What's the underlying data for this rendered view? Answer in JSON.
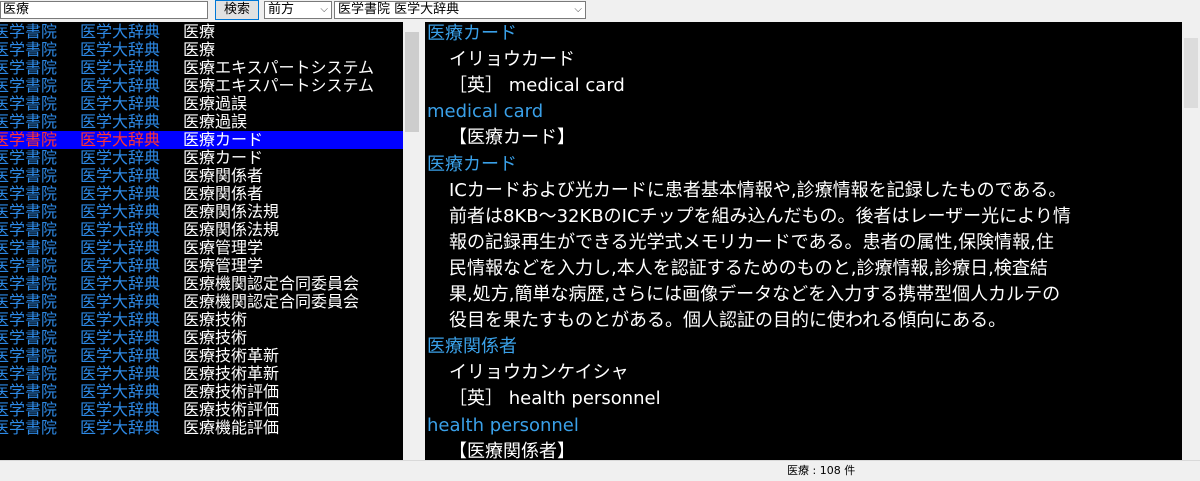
{
  "toolbar": {
    "search_value": "医療",
    "search_button": "検索",
    "match_mode": "前方",
    "dictionary": "医学書院 医学大辞典"
  },
  "results": [
    {
      "src": "医学書院",
      "dic": "医学大辞典",
      "term": "医療"
    },
    {
      "src": "医学書院",
      "dic": "医学大辞典",
      "term": "医療"
    },
    {
      "src": "医学書院",
      "dic": "医学大辞典",
      "term": "医療エキスパートシステム"
    },
    {
      "src": "医学書院",
      "dic": "医学大辞典",
      "term": "医療エキスパートシステム"
    },
    {
      "src": "医学書院",
      "dic": "医学大辞典",
      "term": "医療過誤"
    },
    {
      "src": "医学書院",
      "dic": "医学大辞典",
      "term": "医療過誤"
    },
    {
      "src": "医学書院",
      "dic": "医学大辞典",
      "term": "医療カード"
    },
    {
      "src": "医学書院",
      "dic": "医学大辞典",
      "term": "医療カード"
    },
    {
      "src": "医学書院",
      "dic": "医学大辞典",
      "term": "医療関係者"
    },
    {
      "src": "医学書院",
      "dic": "医学大辞典",
      "term": "医療関係者"
    },
    {
      "src": "医学書院",
      "dic": "医学大辞典",
      "term": "医療関係法規"
    },
    {
      "src": "医学書院",
      "dic": "医学大辞典",
      "term": "医療関係法規"
    },
    {
      "src": "医学書院",
      "dic": "医学大辞典",
      "term": "医療管理学"
    },
    {
      "src": "医学書院",
      "dic": "医学大辞典",
      "term": "医療管理学"
    },
    {
      "src": "医学書院",
      "dic": "医学大辞典",
      "term": "医療機関認定合同委員会"
    },
    {
      "src": "医学書院",
      "dic": "医学大辞典",
      "term": "医療機関認定合同委員会"
    },
    {
      "src": "医学書院",
      "dic": "医学大辞典",
      "term": "医療技術"
    },
    {
      "src": "医学書院",
      "dic": "医学大辞典",
      "term": "医療技術"
    },
    {
      "src": "医学書院",
      "dic": "医学大辞典",
      "term": "医療技術革新"
    },
    {
      "src": "医学書院",
      "dic": "医学大辞典",
      "term": "医療技術革新"
    },
    {
      "src": "医学書院",
      "dic": "医学大辞典",
      "term": "医療技術評価"
    },
    {
      "src": "医学書院",
      "dic": "医学大辞典",
      "term": "医療技術評価"
    },
    {
      "src": "医学書院",
      "dic": "医学大辞典",
      "term": "医療機能評価"
    }
  ],
  "selected_index": 6,
  "content": [
    {
      "kind": "h",
      "text": "医療カード"
    },
    {
      "kind": "t",
      "text": "イリョウカード"
    },
    {
      "kind": "t",
      "text": "［英］ medical card"
    },
    {
      "kind": "h",
      "text": "medical card"
    },
    {
      "kind": "t",
      "text": "【医療カード】"
    },
    {
      "kind": "h",
      "text": "医療カード"
    },
    {
      "kind": "t",
      "text": "ICカードおよび光カードに患者基本情報や,診療情報を記録したものである。"
    },
    {
      "kind": "t",
      "text": "前者は8KB～32KBのICチップを組み込んだもの。後者はレーザー光により情"
    },
    {
      "kind": "t",
      "text": "報の記録再生ができる光学式メモリカードである。患者の属性,保険情報,住"
    },
    {
      "kind": "t",
      "text": "民情報などを入力し,本人を認証するためのものと,診療情報,診療日,検査結"
    },
    {
      "kind": "t",
      "text": "果,処方,簡単な病歴,さらには画像データなどを入力する携帯型個人カルテの"
    },
    {
      "kind": "t",
      "text": "役目を果たすものとがある。個人認証の目的に使われる傾向にある。"
    },
    {
      "kind": "h",
      "text": "医療関係者"
    },
    {
      "kind": "t",
      "text": "イリョウカンケイシャ"
    },
    {
      "kind": "t",
      "text": "［英］ health personnel"
    },
    {
      "kind": "h",
      "text": "health personnel"
    },
    {
      "kind": "t",
      "text": "【医療関係者】"
    }
  ],
  "status": "医療 : 108 件"
}
